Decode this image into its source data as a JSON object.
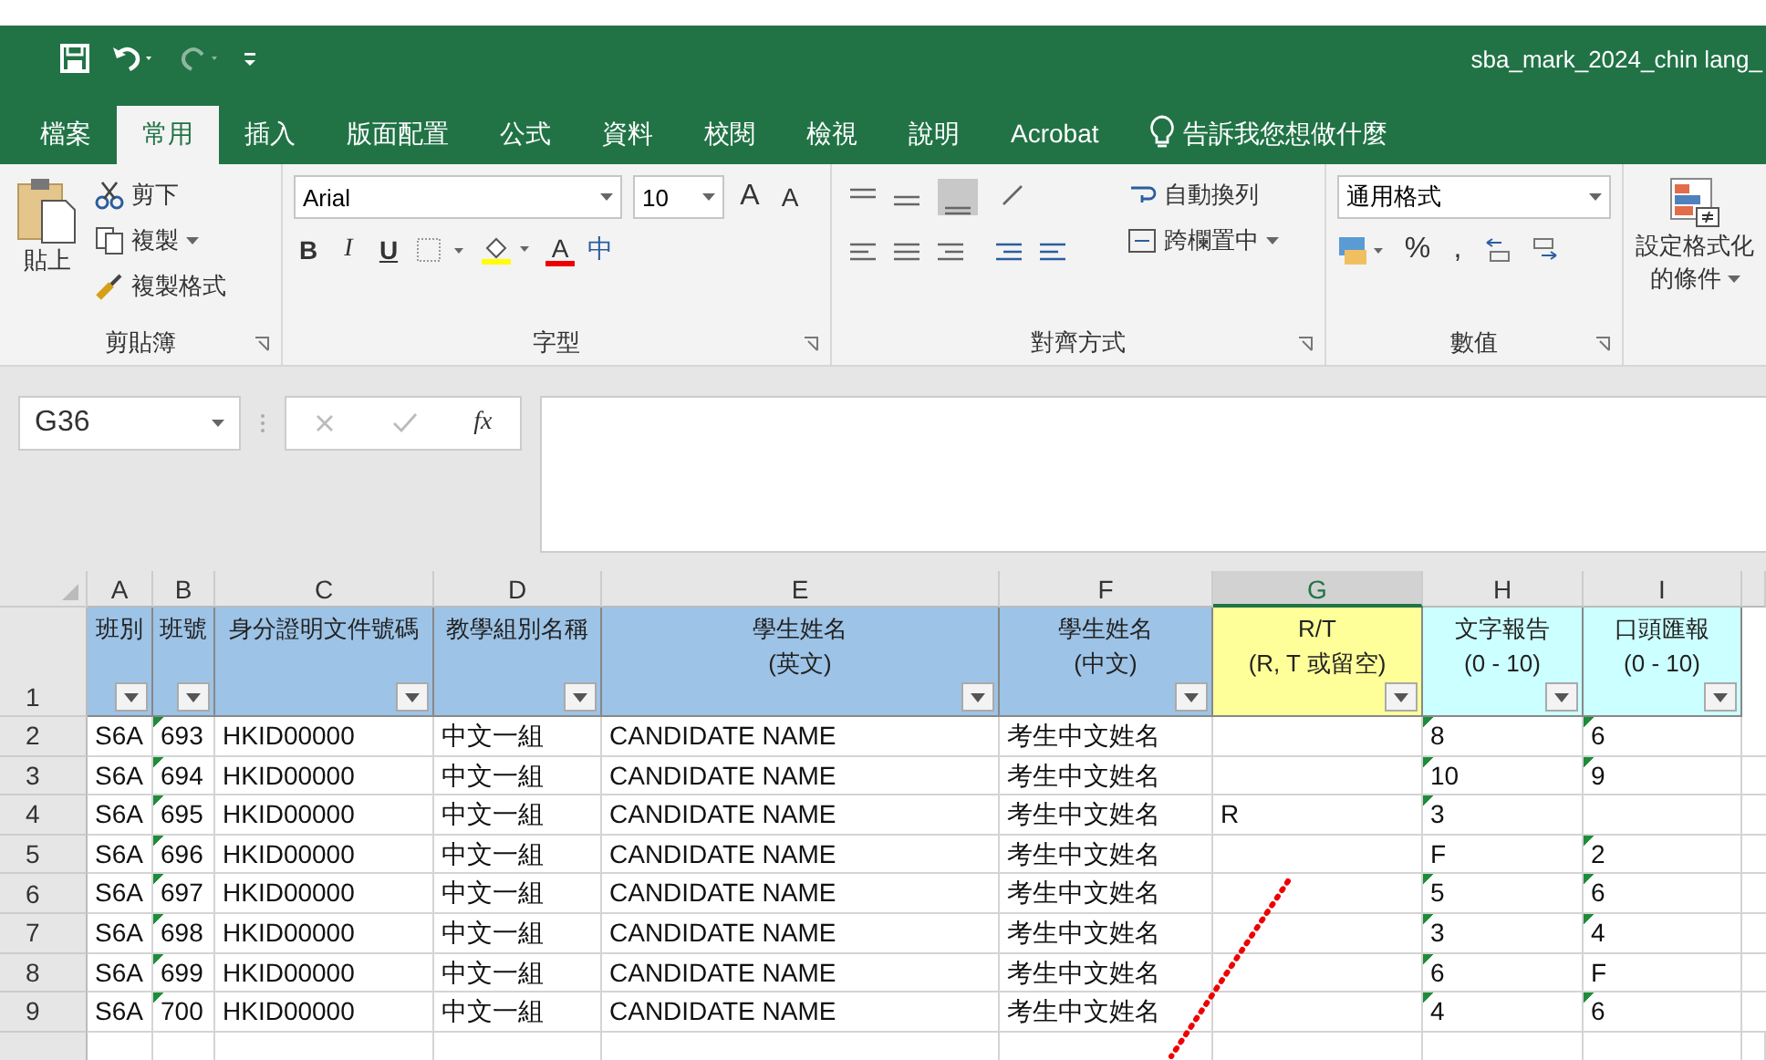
{
  "window": {
    "title": "sba_mark_2024_chin lang_"
  },
  "tabs": [
    {
      "label": "檔案",
      "selected": false
    },
    {
      "label": "常用",
      "selected": true
    },
    {
      "label": "插入",
      "selected": false
    },
    {
      "label": "版面配置",
      "selected": false
    },
    {
      "label": "公式",
      "selected": false
    },
    {
      "label": "資料",
      "selected": false
    },
    {
      "label": "校閱",
      "selected": false
    },
    {
      "label": "檢視",
      "selected": false
    },
    {
      "label": "說明",
      "selected": false
    },
    {
      "label": "Acrobat",
      "selected": false
    }
  ],
  "tell_me": "告訴我您想做什麼",
  "clipboard": {
    "paste": "貼上",
    "cut": "剪下",
    "copy": "複製",
    "format_painter": "複製格式",
    "label": "剪貼簿"
  },
  "font": {
    "name": "Arial",
    "size": "10",
    "grow": "A",
    "shrink": "A",
    "bold": "B",
    "italic": "I",
    "underline": "U",
    "font_color": "A",
    "phonetic": "中",
    "label": "字型"
  },
  "alignment": {
    "wrap": "自動換列",
    "merge": "跨欄置中",
    "label": "對齊方式"
  },
  "number": {
    "format": "通用格式",
    "percent": "%",
    "comma": ",",
    "label": "數值"
  },
  "styles": {
    "conditional": "設定格式化",
    "conditional_2": "的條件"
  },
  "name_box": "G36",
  "fx": "fx",
  "columns": [
    {
      "label": "A",
      "selected": false
    },
    {
      "label": "B",
      "selected": false
    },
    {
      "label": "C",
      "selected": false
    },
    {
      "label": "D",
      "selected": false
    },
    {
      "label": "E",
      "selected": false
    },
    {
      "label": "F",
      "selected": false
    },
    {
      "label": "G",
      "selected": true
    },
    {
      "label": "H",
      "selected": false
    },
    {
      "label": "I",
      "selected": false
    }
  ],
  "header_row": {
    "num": "1",
    "cells": [
      {
        "text": "班別",
        "color": "#9dc3e6"
      },
      {
        "text": "班號",
        "color": "#9dc3e6"
      },
      {
        "text": "身分證明文件號碼",
        "color": "#9dc3e6"
      },
      {
        "text": "教學組別名稱",
        "color": "#9dc3e6"
      },
      {
        "text": "學生姓名\n(英文)",
        "color": "#9dc3e6"
      },
      {
        "text": "學生姓名\n(中文)",
        "color": "#9dc3e6"
      },
      {
        "text": "R/T\n(R, T 或留空)",
        "color": "#ffff99"
      },
      {
        "text": "文字報告\n(0 - 10)",
        "color": "#ccffff"
      },
      {
        "text": "口頭匯報\n(0 - 10)",
        "color": "#ccffff"
      }
    ]
  },
  "rows": [
    {
      "num": "2",
      "cells": [
        {
          "text": "S6A",
          "flagged": false
        },
        {
          "text": "693",
          "flagged": true
        },
        {
          "text": "HKID00000",
          "flagged": false
        },
        {
          "text": "中文一組",
          "flagged": false
        },
        {
          "text": "CANDIDATE NAME",
          "flagged": false
        },
        {
          "text": "考生中文姓名",
          "flagged": false
        },
        {
          "text": "",
          "flagged": false
        },
        {
          "text": "8",
          "flagged": true
        },
        {
          "text": "6",
          "flagged": true
        }
      ]
    },
    {
      "num": "3",
      "cells": [
        {
          "text": "S6A",
          "flagged": false
        },
        {
          "text": "694",
          "flagged": true
        },
        {
          "text": "HKID00000",
          "flagged": false
        },
        {
          "text": "中文一組",
          "flagged": false
        },
        {
          "text": "CANDIDATE NAME",
          "flagged": false
        },
        {
          "text": "考生中文姓名",
          "flagged": false
        },
        {
          "text": "",
          "flagged": false
        },
        {
          "text": "10",
          "flagged": true
        },
        {
          "text": "9",
          "flagged": true
        }
      ]
    },
    {
      "num": "4",
      "cells": [
        {
          "text": "S6A",
          "flagged": false
        },
        {
          "text": "695",
          "flagged": true
        },
        {
          "text": "HKID00000",
          "flagged": false
        },
        {
          "text": "中文一組",
          "flagged": false
        },
        {
          "text": "CANDIDATE NAME",
          "flagged": false
        },
        {
          "text": "考生中文姓名",
          "flagged": false
        },
        {
          "text": "R",
          "flagged": false
        },
        {
          "text": "3",
          "flagged": true
        },
        {
          "text": "",
          "flagged": false
        }
      ]
    },
    {
      "num": "5",
      "cells": [
        {
          "text": "S6A",
          "flagged": false
        },
        {
          "text": "696",
          "flagged": true
        },
        {
          "text": "HKID00000",
          "flagged": false
        },
        {
          "text": "中文一組",
          "flagged": false
        },
        {
          "text": "CANDIDATE NAME",
          "flagged": false
        },
        {
          "text": "考生中文姓名",
          "flagged": false
        },
        {
          "text": "",
          "flagged": false
        },
        {
          "text": "F",
          "flagged": false
        },
        {
          "text": "2",
          "flagged": true
        }
      ]
    },
    {
      "num": "6",
      "cells": [
        {
          "text": "S6A",
          "flagged": false
        },
        {
          "text": "697",
          "flagged": true
        },
        {
          "text": "HKID00000",
          "flagged": false
        },
        {
          "text": "中文一組",
          "flagged": false
        },
        {
          "text": "CANDIDATE NAME",
          "flagged": false
        },
        {
          "text": "考生中文姓名",
          "flagged": false
        },
        {
          "text": "",
          "flagged": false
        },
        {
          "text": "5",
          "flagged": true
        },
        {
          "text": "6",
          "flagged": true
        }
      ]
    },
    {
      "num": "7",
      "cells": [
        {
          "text": "S6A",
          "flagged": false
        },
        {
          "text": "698",
          "flagged": true
        },
        {
          "text": "HKID00000",
          "flagged": false
        },
        {
          "text": "中文一組",
          "flagged": false
        },
        {
          "text": "CANDIDATE NAME",
          "flagged": false
        },
        {
          "text": "考生中文姓名",
          "flagged": false
        },
        {
          "text": "",
          "flagged": false
        },
        {
          "text": "3",
          "flagged": true
        },
        {
          "text": "4",
          "flagged": true
        }
      ]
    },
    {
      "num": "8",
      "cells": [
        {
          "text": "S6A",
          "flagged": false
        },
        {
          "text": "699",
          "flagged": true
        },
        {
          "text": "HKID00000",
          "flagged": false
        },
        {
          "text": "中文一組",
          "flagged": false
        },
        {
          "text": "CANDIDATE NAME",
          "flagged": false
        },
        {
          "text": "考生中文姓名",
          "flagged": false
        },
        {
          "text": "",
          "flagged": false
        },
        {
          "text": "6",
          "flagged": true
        },
        {
          "text": "F",
          "flagged": false
        }
      ]
    },
    {
      "num": "9",
      "cells": [
        {
          "text": "S6A",
          "flagged": false
        },
        {
          "text": "700",
          "flagged": true
        },
        {
          "text": "HKID00000",
          "flagged": false
        },
        {
          "text": "中文一組",
          "flagged": false
        },
        {
          "text": "CANDIDATE NAME",
          "flagged": false
        },
        {
          "text": "考生中文姓名",
          "flagged": false
        },
        {
          "text": "",
          "flagged": false
        },
        {
          "text": "4",
          "flagged": true
        },
        {
          "text": "6",
          "flagged": true
        }
      ]
    }
  ]
}
